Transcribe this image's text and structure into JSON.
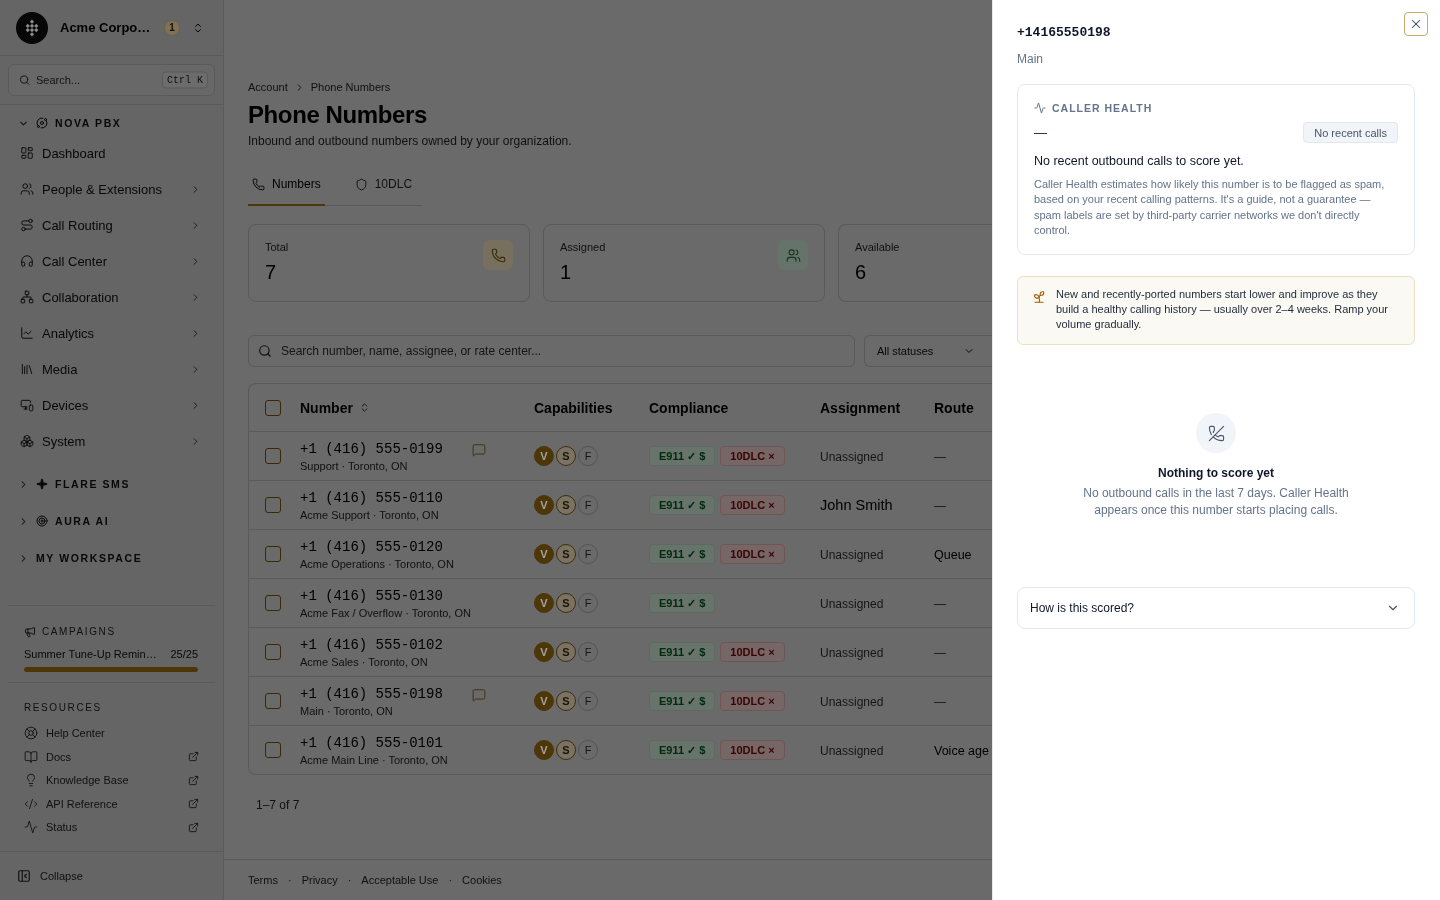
{
  "sidebar": {
    "org": {
      "name": "Acme Corpo…",
      "badge": "1"
    },
    "search": {
      "placeholder": "Search...",
      "shortcut": "Ctrl K"
    },
    "sections": [
      {
        "label": "NOVA PBX",
        "expanded": true,
        "items": [
          {
            "label": "Dashboard",
            "submenu": false
          },
          {
            "label": "People & Extensions",
            "submenu": true
          },
          {
            "label": "Call Routing",
            "submenu": true
          },
          {
            "label": "Call Center",
            "submenu": true
          },
          {
            "label": "Collaboration",
            "submenu": true
          },
          {
            "label": "Analytics",
            "submenu": true
          },
          {
            "label": "Media",
            "submenu": true
          },
          {
            "label": "Devices",
            "submenu": true
          },
          {
            "label": "System",
            "submenu": true
          }
        ]
      },
      {
        "label": "FLARE SMS",
        "expanded": false
      },
      {
        "label": "AURA AI",
        "expanded": false
      },
      {
        "label": "MY WORKSPACE",
        "expanded": false
      }
    ],
    "campaigns": {
      "title": "CAMPAIGNS",
      "items": [
        {
          "name": "Summer Tune-Up Remin…",
          "count": "25/25",
          "level": 1
        }
      ]
    },
    "resources": {
      "title": "RESOURCES",
      "items": [
        {
          "label": "Help Center",
          "external": false
        },
        {
          "label": "Docs",
          "external": true
        },
        {
          "label": "Knowledge Base",
          "external": true
        },
        {
          "label": "API Reference",
          "external": true
        },
        {
          "label": "Status",
          "external": true
        }
      ]
    },
    "collapse": {
      "label": "Collapse"
    }
  },
  "main": {
    "breadcrumb": [
      "Account",
      "Phone Numbers"
    ],
    "title": "Phone Numbers",
    "subtitle": "Inbound and outbound numbers owned by your organization.",
    "tabs": [
      {
        "label": "Numbers",
        "selected": true
      },
      {
        "label": "10DLC",
        "selected": false
      }
    ],
    "stats": [
      {
        "label": "Total",
        "value": "7"
      },
      {
        "label": "Assigned",
        "value": "1"
      },
      {
        "label": "Available",
        "value": "6"
      }
    ],
    "search": {
      "placeholder": "Search number, name, assignee, or rate center..."
    },
    "filter": {
      "value": "All statuses"
    },
    "table": {
      "select_all": {
        "checked": false
      },
      "columns": [
        {
          "label": "Number",
          "sortable": true
        },
        {
          "label": "Capabilities",
          "sortable": false
        },
        {
          "label": "Compliance",
          "sortable": false
        },
        {
          "label": "Assignment",
          "sortable": false
        },
        {
          "label": "Route",
          "sortable": false
        }
      ],
      "rows": [
        {
          "checked": false,
          "number": "+1 (416) 555-0199",
          "detail": "Support · Toronto, ON",
          "note": true,
          "capabilities": [
            {
              "label": "V",
              "kind": "active"
            },
            {
              "label": "S",
              "kind": "partial"
            },
            {
              "label": "F",
              "kind": "inactive"
            }
          ],
          "compliance": [
            {
              "label": "E911 ✓ $",
              "ok": true
            },
            {
              "label": "10DLC ×",
              "ok": false
            }
          ],
          "assignment": {
            "text": "Unassigned",
            "assigned": false
          },
          "route": {
            "text": "—",
            "set": false
          }
        },
        {
          "checked": false,
          "number": "+1 (416) 555-0110",
          "detail": "Acme Support · Toronto, ON",
          "note": false,
          "capabilities": [
            {
              "label": "V",
              "kind": "active"
            },
            {
              "label": "S",
              "kind": "partial"
            },
            {
              "label": "F",
              "kind": "inactive"
            }
          ],
          "compliance": [
            {
              "label": "E911 ✓ $",
              "ok": true
            },
            {
              "label": "10DLC ×",
              "ok": false
            }
          ],
          "assignment": {
            "text": "John Smith",
            "assigned": true
          },
          "route": {
            "text": "—",
            "set": false
          }
        },
        {
          "checked": false,
          "number": "+1 (416) 555-0120",
          "detail": "Acme Operations · Toronto, ON",
          "note": false,
          "capabilities": [
            {
              "label": "V",
              "kind": "active"
            },
            {
              "label": "S",
              "kind": "partial"
            },
            {
              "label": "F",
              "kind": "inactive"
            }
          ],
          "compliance": [
            {
              "label": "E911 ✓ $",
              "ok": true
            },
            {
              "label": "10DLC ×",
              "ok": false
            }
          ],
          "assignment": {
            "text": "Unassigned",
            "assigned": false
          },
          "route": {
            "text": "Queue",
            "set": true
          }
        },
        {
          "checked": false,
          "number": "+1 (416) 555-0130",
          "detail": "Acme Fax / Overflow · Toronto, ON",
          "note": false,
          "capabilities": [
            {
              "label": "V",
              "kind": "active"
            },
            {
              "label": "S",
              "kind": "partial"
            },
            {
              "label": "F",
              "kind": "inactive"
            }
          ],
          "compliance": [
            {
              "label": "E911 ✓ $",
              "ok": true
            }
          ],
          "assignment": {
            "text": "Unassigned",
            "assigned": false
          },
          "route": {
            "text": "—",
            "set": false
          }
        },
        {
          "checked": false,
          "number": "+1 (416) 555-0102",
          "detail": "Acme Sales · Toronto, ON",
          "note": false,
          "capabilities": [
            {
              "label": "V",
              "kind": "active"
            },
            {
              "label": "S",
              "kind": "partial"
            },
            {
              "label": "F",
              "kind": "inactive"
            }
          ],
          "compliance": [
            {
              "label": "E911 ✓ $",
              "ok": true
            },
            {
              "label": "10DLC ×",
              "ok": false
            }
          ],
          "assignment": {
            "text": "Unassigned",
            "assigned": false
          },
          "route": {
            "text": "—",
            "set": false
          }
        },
        {
          "checked": false,
          "number": "+1 (416) 555-0198",
          "detail": "Main · Toronto, ON",
          "note": true,
          "capabilities": [
            {
              "label": "V",
              "kind": "active"
            },
            {
              "label": "S",
              "kind": "partial"
            },
            {
              "label": "F",
              "kind": "inactive"
            }
          ],
          "compliance": [
            {
              "label": "E911 ✓ $",
              "ok": true
            },
            {
              "label": "10DLC ×",
              "ok": false
            }
          ],
          "assignment": {
            "text": "Unassigned",
            "assigned": false
          },
          "route": {
            "text": "—",
            "set": false
          }
        },
        {
          "checked": false,
          "number": "+1 (416) 555-0101",
          "detail": "Acme Main Line · Toronto, ON",
          "note": false,
          "capabilities": [
            {
              "label": "V",
              "kind": "active"
            },
            {
              "label": "S",
              "kind": "partial"
            },
            {
              "label": "F",
              "kind": "inactive"
            }
          ],
          "compliance": [
            {
              "label": "E911 ✓ $",
              "ok": true
            },
            {
              "label": "10DLC ×",
              "ok": false
            }
          ],
          "assignment": {
            "text": "Unassigned",
            "assigned": false
          },
          "route": {
            "text": "Voice age",
            "set": true
          }
        }
      ]
    },
    "pagination": "1–7 of 7",
    "footer": {
      "links": [
        {
          "label": "Terms"
        },
        {
          "separator": "·",
          "label": "Privacy"
        },
        {
          "separator": "·",
          "label": "Acceptable Use"
        },
        {
          "separator": "·",
          "label": "Cookies"
        }
      ]
    }
  },
  "drawer": {
    "title": "+14165550198",
    "subtitle": "Main",
    "caller_health": {
      "heading": "CALLER HEALTH",
      "score": "—",
      "status": "No recent calls",
      "summary": "No recent outbound calls to score yet.",
      "description": "Caller Health estimates how likely this number is to be flagged as spam, based on your recent calling patterns. It's a guide, not a guarantee — spam labels are set by third-party carrier networks we don't directly control."
    },
    "tip": {
      "text": "New and recently-ported numbers start lower and improve as they build a healthy calling history — usually over 2–4 weeks. Ramp your volume gradually."
    },
    "empty_state": {
      "title": "Nothing to score yet",
      "description": "No outbound calls in the last 7 days. Caller Health appears once this number starts placing calls."
    },
    "accordion": [
      {
        "label": "How is this scored?",
        "expanded": false
      }
    ]
  }
}
